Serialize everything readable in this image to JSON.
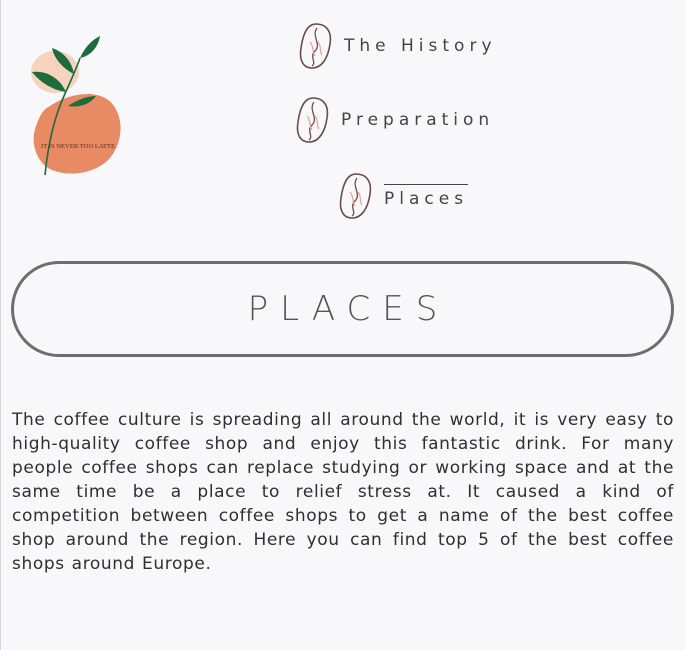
{
  "logo": {
    "text": "IT IS NEVER TOO LATTE",
    "colors": {
      "leaf": "#1e6b3c",
      "blob_light": "#f5d3bd",
      "blob_dark": "#e88a63"
    }
  },
  "nav": {
    "items": [
      {
        "label": "The History",
        "icon": "coffee-bean-icon",
        "active": false
      },
      {
        "label": "Preparation",
        "icon": "coffee-bean-icon",
        "active": false
      },
      {
        "label": "Places",
        "icon": "coffee-bean-icon",
        "active": true
      }
    ]
  },
  "page": {
    "title": "Places",
    "intro": "The coffee culture is spreading all around the world, it is very easy to high-quality coffee shop and enjoy this fantastic drink. For many people coffee shops can replace studying or working space and at the same time be a place to relief stress at. It caused a kind of competition between coffee shops to get a name of the best coffee shop around the region. Here you can find top 5 of the best coffee shops around Europe."
  },
  "colors": {
    "background": "#f8f8fa",
    "border": "#6e6e6e",
    "bean_outline": "#6b4e49",
    "bean_accent": "#e7a08e"
  }
}
